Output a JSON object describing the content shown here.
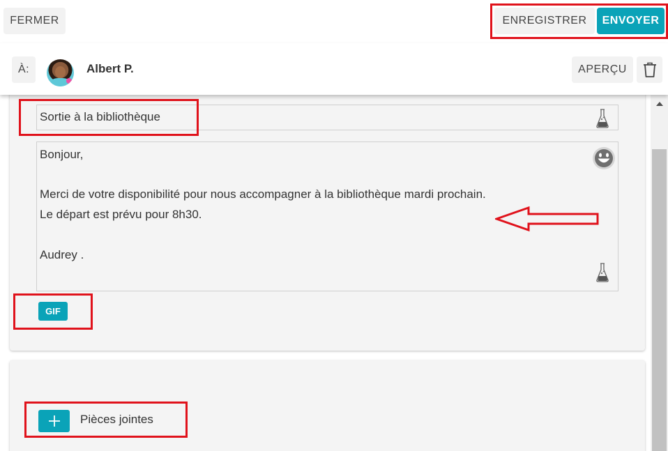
{
  "toolbar": {
    "close_label": "FERMER",
    "save_label": "ENREGISTRER",
    "send_label": "ENVOYER"
  },
  "recipient": {
    "to_label": "À:",
    "name": "Albert P.",
    "preview_label": "APERÇU"
  },
  "message": {
    "subject": "Sortie à la bibliothèque",
    "body_lines": [
      "Bonjour,",
      "Merci de votre disponibilité pour nous accompagner à la bibliothèque mardi prochain.",
      "Le départ est prévu pour 8h30.",
      "Audrey ."
    ],
    "gif_label": "GIF"
  },
  "attachments": {
    "label": "Pièces jointes"
  },
  "icons": {
    "trash": "trash-icon",
    "smiley": "smiley-icon",
    "flask": "flask-icon",
    "plus": "plus-icon"
  },
  "colors": {
    "accent": "#0aa3b8",
    "highlight": "#e0121b"
  }
}
